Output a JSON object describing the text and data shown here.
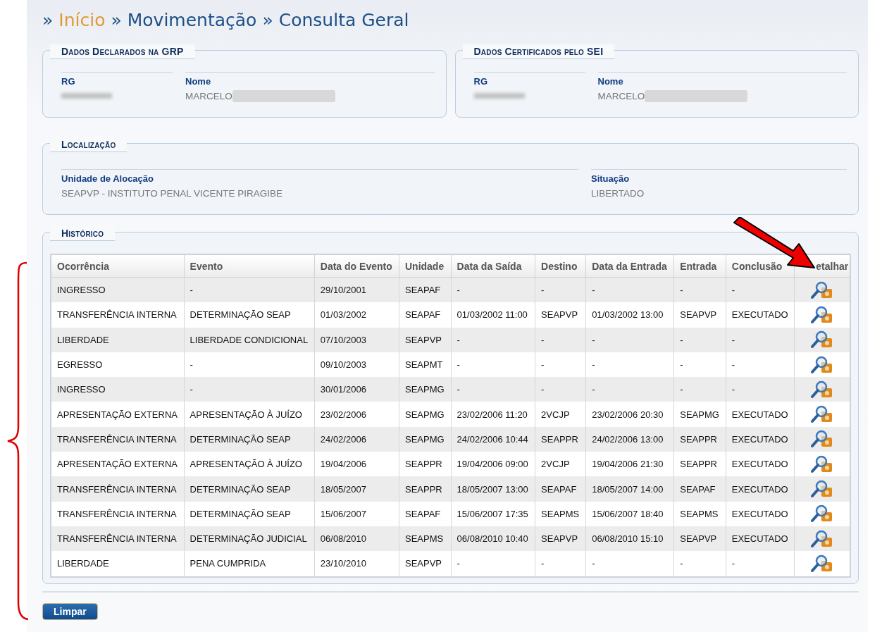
{
  "breadcrumb": [
    {
      "label": "»",
      "kind": "sep"
    },
    {
      "label": "Início",
      "kind": "link"
    },
    {
      "label": "»",
      "kind": "sep"
    },
    {
      "label": "Movimentação",
      "kind": "current"
    },
    {
      "label": "»",
      "kind": "sep"
    },
    {
      "label": "Consulta Geral",
      "kind": "current"
    }
  ],
  "panels": [
    {
      "legend": "Dados Declarados na GRP",
      "fields": [
        {
          "label": "RG",
          "redacted": true
        },
        {
          "label": "Nome",
          "value": "MARCELO",
          "redacted": true
        }
      ]
    },
    {
      "legend": "Dados Certificados pelo SEI",
      "fields": [
        {
          "label": "RG",
          "redacted": true
        },
        {
          "label": "Nome",
          "value": "MARCELO",
          "redacted": true
        }
      ]
    }
  ],
  "location": {
    "legend": "Localização",
    "fields": [
      {
        "label": "Unidade de Alocação",
        "value": "SEAPVP - INSTITUTO PENAL VICENTE PIRAGIBE"
      },
      {
        "label": "Situação",
        "value": "LIBERTADO"
      }
    ]
  },
  "history": {
    "legend": "Histórico",
    "columns": [
      "Ocorrência",
      "Evento",
      "Data do Evento",
      "Unidade",
      "Data da Saída",
      "Destino",
      "Data da Entrada",
      "Entrada",
      "Conclusão",
      "etalhar"
    ],
    "rows": [
      [
        "INGRESSO",
        "-",
        "29/10/2001",
        "SEAPAF",
        "-",
        "-",
        "-",
        "-",
        "-"
      ],
      [
        "TRANSFERÊNCIA INTERNA",
        "DETERMINAÇÃO SEAP",
        "01/03/2002",
        "SEAPAF",
        "01/03/2002 11:00",
        "SEAPVP",
        "01/03/2002 13:00",
        "SEAPVP",
        "EXECUTADO"
      ],
      [
        "LIBERDADE",
        "LIBERDADE CONDICIONAL",
        "07/10/2003",
        "SEAPVP",
        "-",
        "-",
        "-",
        "-",
        "-"
      ],
      [
        "EGRESSO",
        "-",
        "09/10/2003",
        "SEAPMT",
        "-",
        "-",
        "-",
        "-",
        "-"
      ],
      [
        "INGRESSO",
        "-",
        "30/01/2006",
        "SEAPMG",
        "-",
        "-",
        "-",
        "-",
        "-"
      ],
      [
        "APRESENTAÇÃO EXTERNA",
        "APRESENTAÇÃO À JUÍZO",
        "23/02/2006",
        "SEAPMG",
        "23/02/2006 11:20",
        "2VCJP",
        "23/02/2006 20:30",
        "SEAPMG",
        "EXECUTADO"
      ],
      [
        "TRANSFERÊNCIA INTERNA",
        "DETERMINAÇÃO SEAP",
        "24/02/2006",
        "SEAPMG",
        "24/02/2006 10:44",
        "SEAPPR",
        "24/02/2006 13:00",
        "SEAPPR",
        "EXECUTADO"
      ],
      [
        "APRESENTAÇÃO EXTERNA",
        "APRESENTAÇÃO À JUÍZO",
        "19/04/2006",
        "SEAPPR",
        "19/04/2006 09:00",
        "2VCJP",
        "19/04/2006 21:30",
        "SEAPPR",
        "EXECUTADO"
      ],
      [
        "TRANSFERÊNCIA INTERNA",
        "DETERMINAÇÃO SEAP",
        "18/05/2007",
        "SEAPPR",
        "18/05/2007 13:00",
        "SEAPAF",
        "18/05/2007 14:00",
        "SEAPAF",
        "EXECUTADO"
      ],
      [
        "TRANSFERÊNCIA INTERNA",
        "DETERMINAÇÃO SEAP",
        "15/06/2007",
        "SEAPAF",
        "15/06/2007 17:35",
        "SEAPMS",
        "15/06/2007 18:40",
        "SEAPMS",
        "EXECUTADO"
      ],
      [
        "TRANSFERÊNCIA INTERNA",
        "DETERMINAÇÃO JUDICIAL",
        "06/08/2010",
        "SEAPMS",
        "06/08/2010 10:40",
        "SEAPVP",
        "06/08/2010 15:10",
        "SEAPVP",
        "EXECUTADO"
      ],
      [
        "LIBERDADE",
        "PENA CUMPRIDA",
        "23/10/2010",
        "SEAPVP",
        "-",
        "-",
        "-",
        "-",
        "-"
      ]
    ]
  },
  "button": "Limpar"
}
